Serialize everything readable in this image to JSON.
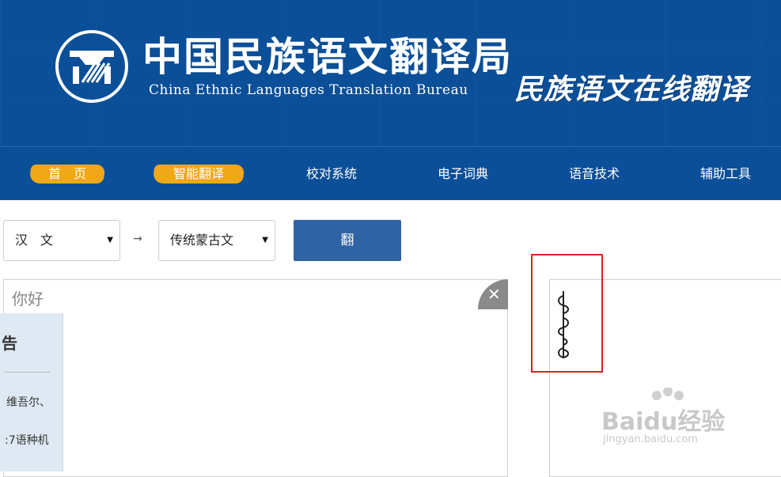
{
  "header": {
    "title_cn": "中国民族语文翻译局",
    "title_en": "China Ethnic Languages Translation Bureau",
    "slogan": "民族语文在线翻译"
  },
  "nav": {
    "items": [
      {
        "label": "首　页",
        "active": true
      },
      {
        "label": "智能翻译",
        "active": true
      },
      {
        "label": "校对系统",
        "active": false
      },
      {
        "label": "电子词典",
        "active": false
      },
      {
        "label": "语音技术",
        "active": false
      },
      {
        "label": "辅助工具",
        "active": false
      }
    ]
  },
  "controls": {
    "source_lang": "汉　文",
    "arrow": "→",
    "target_lang": "传统蒙古文",
    "translate_button": "翻　译"
  },
  "source_panel": {
    "text": "你好",
    "clear_icon": "close-icon"
  },
  "notice": {
    "title": "告",
    "line1": "维吾尔、",
    "line2": ":7语种机"
  },
  "watermark": {
    "text": "Baidu经验",
    "sub": "jingyan.baidu.com"
  },
  "colors": {
    "header_bg": "#0b4f98",
    "active_nav": "#f0a818",
    "button": "#2f63a4",
    "highlight": "#e02020"
  }
}
